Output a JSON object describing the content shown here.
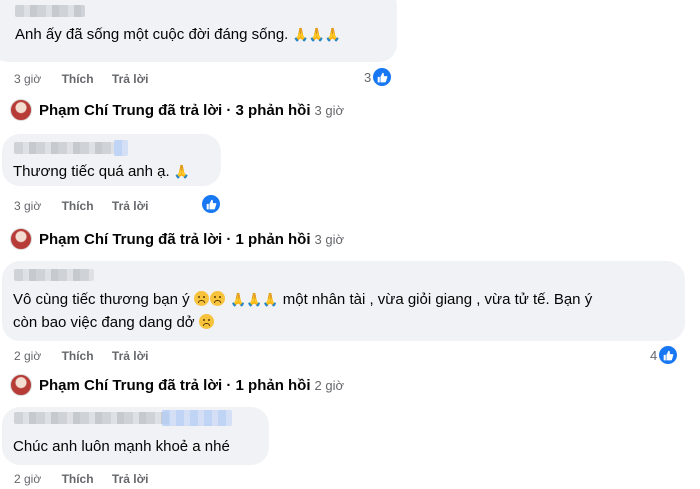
{
  "comments": [
    {
      "text": "Anh ấy đã sống một cuộc đời đáng sống.",
      "emoji": [
        "🙏",
        "🙏",
        "🙏"
      ],
      "time": "3 giờ",
      "like_label": "Thích",
      "reply_label": "Trả lời",
      "likes": "3"
    },
    {
      "text": "Thương tiếc quá anh ạ.",
      "emoji": [
        "🙏"
      ],
      "time": "3 giờ",
      "like_label": "Thích",
      "reply_label": "Trả lời",
      "likes": ""
    },
    {
      "line1_a": "Vô cùng tiếc thương bạn ý",
      "line1_b": "một nhân tài , vừa giỏi giang , vừa tử tế. Bạn ý",
      "line2": "còn bao việc đang dang dở",
      "emoji": [
        "🙏",
        "🙏",
        "🙏"
      ],
      "time": "2 giờ",
      "like_label": "Thích",
      "reply_label": "Trả lời",
      "likes": "4"
    },
    {
      "text": "Chúc anh luôn mạnh khoẻ a nhé",
      "time": "2 giờ",
      "like_label": "Thích",
      "reply_label": "Trả lời"
    }
  ],
  "replies": [
    {
      "summary": "Phạm Chí Trung đã trả lời · 3 phản hồi",
      "time": "3 giờ"
    },
    {
      "summary": "Phạm Chí Trung đã trả lời · 1 phản hồi",
      "time": "3 giờ"
    },
    {
      "summary": "Phạm Chí Trung đã trả lời · 1 phản hồi",
      "time": "2 giờ"
    }
  ],
  "colors": {
    "like_blue": "#1877f2",
    "bubble": "#f0f2f5",
    "meta": "#65676b"
  }
}
